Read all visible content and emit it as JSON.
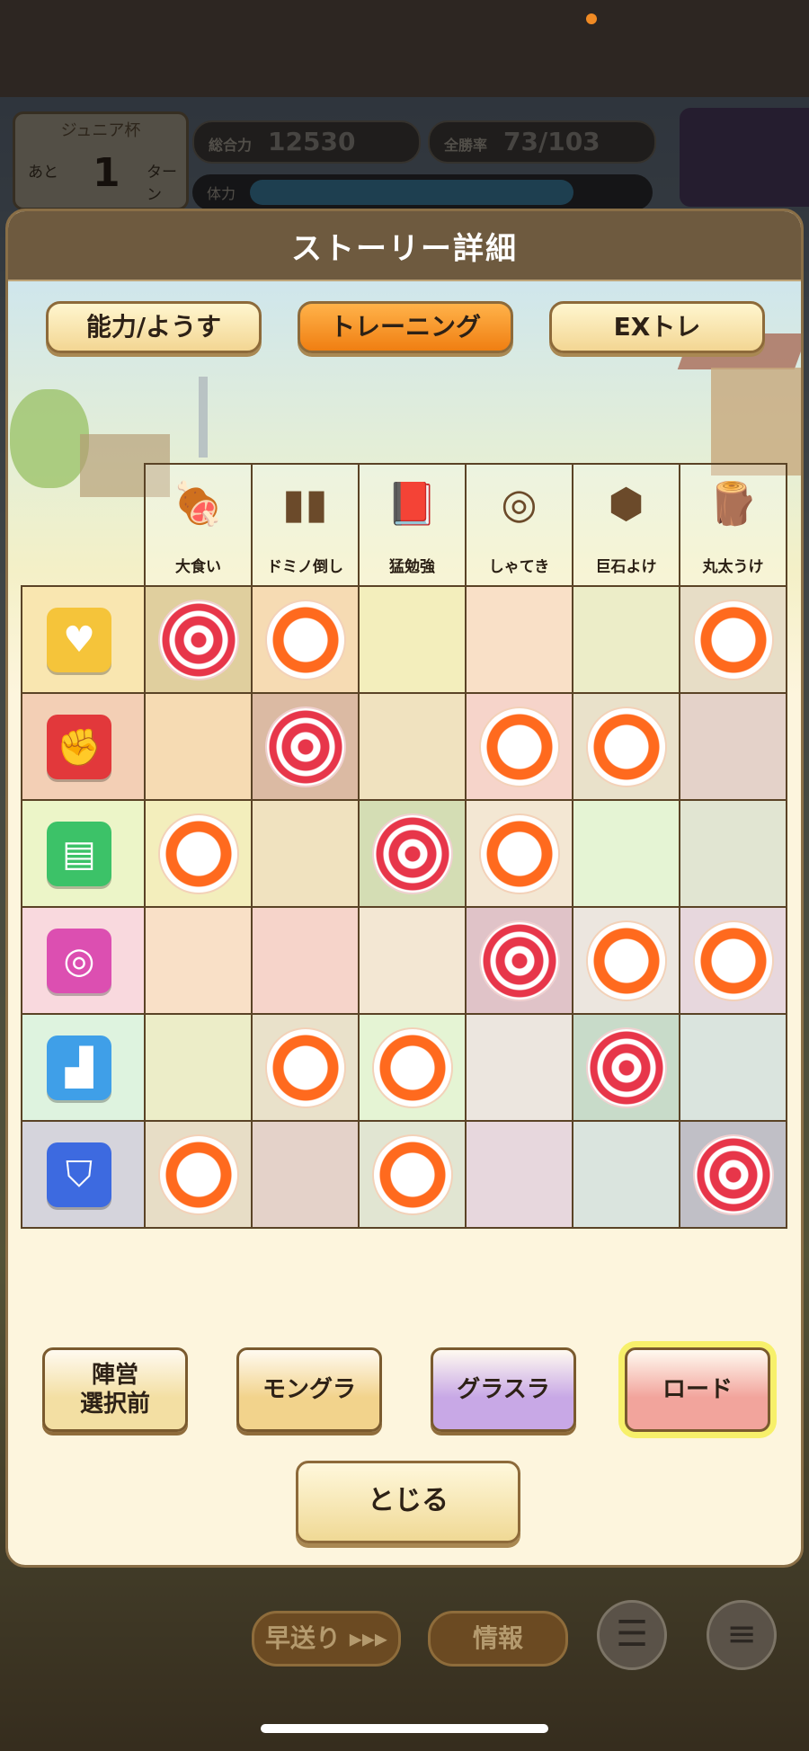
{
  "hud": {
    "rank_title": "ジュニア杯",
    "stage_prefix": "あと",
    "stage_number": "1",
    "stage_unit": "ターン",
    "power_label": "総合力",
    "power_value": "12530",
    "progress_label": "全勝率",
    "progress_value": "73/103",
    "stamina_label": "体力",
    "bottom_btn_skip": "早送り ▸▸▸",
    "bottom_btn_info": "情報"
  },
  "modal": {
    "title": "ストーリー詳細",
    "tabs": [
      {
        "label": "能力/ようす"
      },
      {
        "label": "トレーニング",
        "active": true
      },
      {
        "label": "EXトレ"
      }
    ],
    "columns": [
      {
        "label": "大食い",
        "icon": "food-icon"
      },
      {
        "label": "ドミノ倒し",
        "icon": "domino-icon"
      },
      {
        "label": "猛勉強",
        "icon": "book-icon"
      },
      {
        "label": "しゃてき",
        "icon": "shooting-target-icon"
      },
      {
        "label": "巨石よけ",
        "icon": "boulder-icon"
      },
      {
        "label": "丸太うけ",
        "icon": "log-icon"
      }
    ],
    "rows": [
      {
        "stat": "life",
        "icon": "heart-icon",
        "color": "#f5c43a",
        "bg": "#f9e6b0",
        "marks": [
          "target",
          "circle",
          "",
          "",
          "",
          "circle"
        ]
      },
      {
        "stat": "power",
        "icon": "boxing-glove-icon",
        "color": "#e2383b",
        "bg": "#f3cfb5",
        "marks": [
          "",
          "target",
          "",
          "circle",
          "circle",
          ""
        ]
      },
      {
        "stat": "intelligence",
        "icon": "book-stat-icon",
        "color": "#3cc268",
        "bg": "#ecf5c8",
        "marks": [
          "circle",
          "",
          "target",
          "circle",
          "",
          ""
        ]
      },
      {
        "stat": "accuracy",
        "icon": "dart-target-icon",
        "color": "#dc4fb1",
        "bg": "#f9d9de",
        "marks": [
          "",
          "",
          "",
          "target",
          "circle",
          "circle"
        ]
      },
      {
        "stat": "speed",
        "icon": "boot-icon",
        "color": "#3f9fe8",
        "bg": "#def3df",
        "marks": [
          "",
          "circle",
          "circle",
          "",
          "target",
          ""
        ]
      },
      {
        "stat": "defense",
        "icon": "shield-icon",
        "color": "#3d6ae0",
        "bg": "#d5d4dc",
        "marks": [
          "circle",
          "",
          "circle",
          "",
          "",
          "target"
        ]
      }
    ],
    "footer_buttons": [
      {
        "label": "陣営\n選択前",
        "color": "#f3dfa3"
      },
      {
        "label": "モングラ",
        "color": "#f2d38c"
      },
      {
        "label": "グラスラ",
        "color": "#c8a8e6"
      },
      {
        "label": "ロード",
        "color": "#f2a49c",
        "highlight": true
      }
    ],
    "close_label": "とじる"
  }
}
